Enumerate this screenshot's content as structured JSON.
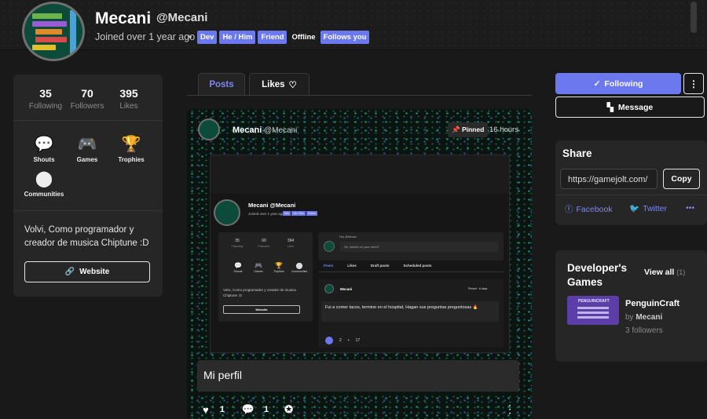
{
  "profile": {
    "name": "Mecani",
    "handle": "@Mecani",
    "joined": "Joined over 1 year ago",
    "bullet": "•",
    "tags": [
      "Dev",
      "He / Him",
      "Friend",
      "Offline",
      "Follows you"
    ]
  },
  "stats": [
    {
      "value": "35",
      "label": "Following"
    },
    {
      "value": "70",
      "label": "Followers"
    },
    {
      "value": "395",
      "label": "Likes"
    }
  ],
  "nav_icons": [
    {
      "label": "Shouts",
      "icon": "chat-bubble-icon"
    },
    {
      "label": "Games",
      "icon": "gamepad-icon"
    },
    {
      "label": "Trophies",
      "icon": "trophy-icon"
    },
    {
      "label": "Communities",
      "icon": "communities-icon"
    }
  ],
  "bio": "Volvi, Como programador y creador de musica Chiptune :D",
  "website_label": "Website",
  "tabs": {
    "posts": "Posts",
    "likes": "Likes"
  },
  "post": {
    "author": "Mecani",
    "handle": "@Mecani",
    "pinned": "Pinned",
    "time": "16 hours",
    "caption": "Mi perfil",
    "likes": "1",
    "comments": "1"
  },
  "screenshot": {
    "name": "Mecani",
    "handle": "@Mecani",
    "joined": "Joined over 1 year ago",
    "tags": [
      "Dev",
      "He / Him",
      "Online"
    ],
    "stats": [
      {
        "value": "35",
        "label": "Following"
      },
      {
        "value": "69",
        "label": "Followers"
      },
      {
        "value": "394",
        "label": "Likes"
      }
    ],
    "icons": [
      "Shouts",
      "Games",
      "Trophies",
      "Communities"
    ],
    "bio": "Volvi, Como programador y creador de musica Chiptune :D",
    "website": "Website",
    "hey": "Hey @Mecani",
    "input_placeholder": "So, what's on your mind?",
    "tabs": [
      "Posts",
      "Likes",
      "Draft posts",
      "Scheduled posts"
    ],
    "post_author": "Mecani",
    "post_pinned": "Pinned · 6 days",
    "post_text": "Fui a comer tacos, termine en el hospital, Hagan sus preguntas preguntosas 🔥",
    "post_likes": "2",
    "post_comments": "17"
  },
  "actions": {
    "following": "Following",
    "message": "Message"
  },
  "share": {
    "title": "Share",
    "url": "https://gamejolt.com/",
    "copy": "Copy",
    "facebook": "Facebook",
    "twitter": "Twitter"
  },
  "dev_games": {
    "title": "Developer's Games",
    "view_all": "View all",
    "count": "(1)",
    "game": {
      "name": "PenguinCraft",
      "by": "by",
      "author": "Mecani",
      "followers": "3 followers",
      "thumb_title": "PENGUINCRAFT"
    }
  },
  "colors": {
    "accent": "#6c78ee",
    "background": "#191919",
    "card": "#262626"
  }
}
